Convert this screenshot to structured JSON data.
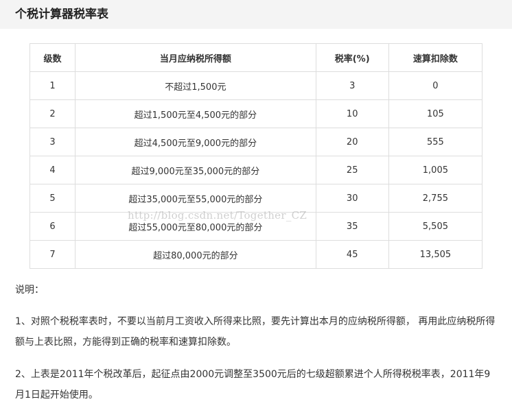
{
  "page": {
    "title": "个税计算器税率表"
  },
  "table": {
    "headers": [
      "级数",
      "当月应纳税所得额",
      "税率(%)",
      "速算扣除数"
    ],
    "rows": [
      {
        "level": "1",
        "range": "不超过1,500元",
        "rate": "3",
        "deduction": "0"
      },
      {
        "level": "2",
        "range": "超过1,500元至4,500元的部分",
        "rate": "10",
        "deduction": "105"
      },
      {
        "level": "3",
        "range": "超过4,500元至9,000元的部分",
        "rate": "20",
        "deduction": "555"
      },
      {
        "level": "4",
        "range": "超过9,000元至35,000元的部分",
        "rate": "25",
        "deduction": "1,005"
      },
      {
        "level": "5",
        "range": "超过35,000元至55,000元的部分",
        "rate": "30",
        "deduction": "2,755"
      },
      {
        "level": "6",
        "range": "超过55,000元至80,000元的部分",
        "rate": "35",
        "deduction": "5,505"
      },
      {
        "level": "7",
        "range": "超过80,000元的部分",
        "rate": "45",
        "deduction": "13,505"
      }
    ]
  },
  "watermark": "http://blog.csdn.net/Together_CZ",
  "notes": {
    "label": "说明：",
    "items": [
      "1、对照个税税率表时，不要以当前月工资收入所得来比照，要先计算出本月的应纳税所得额， 再用此应纳税所得额与上表比照，方能得到正确的税率和速算扣除数。",
      "2、上表是2011年个税改革后，起征点由2000元调整至3500元后的七级超额累进个人所得税税率表，2011年9月1日起开始使用。"
    ]
  }
}
